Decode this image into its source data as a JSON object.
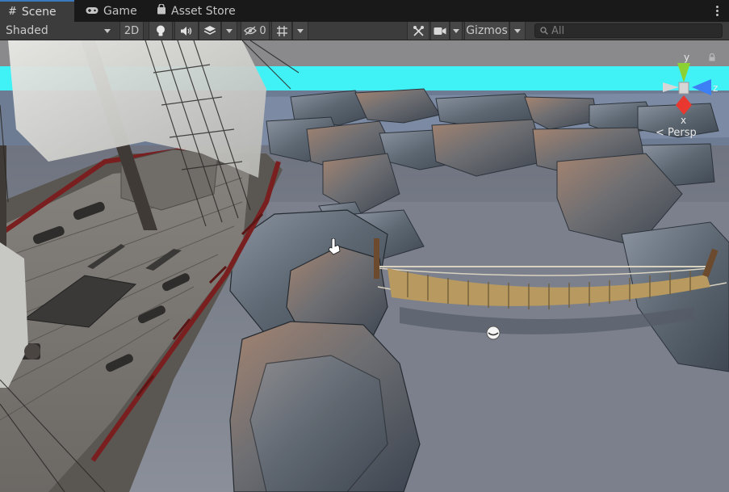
{
  "tabs": [
    {
      "label": "Scene",
      "icon": "hash-icon",
      "active": true
    },
    {
      "label": "Game",
      "icon": "gamepad-icon",
      "active": false
    },
    {
      "label": "Asset Store",
      "icon": "shopping-bag-icon",
      "active": false
    }
  ],
  "toolbar": {
    "shading_mode": "Shaded",
    "two_d_label": "2D",
    "hidden_count": "0",
    "gizmos_label": "Gizmos",
    "search_placeholder": "All"
  },
  "viewport": {
    "projection_label": "Persp",
    "gizmo_axes": {
      "y": "y",
      "z": "z",
      "x": "x"
    }
  },
  "colors": {
    "axis_y": "#8cd133",
    "axis_z": "#3d7ff5",
    "axis_x": "#e8382f",
    "sky": "#40f2f5",
    "active_tab_accent": "#3a79bb"
  }
}
